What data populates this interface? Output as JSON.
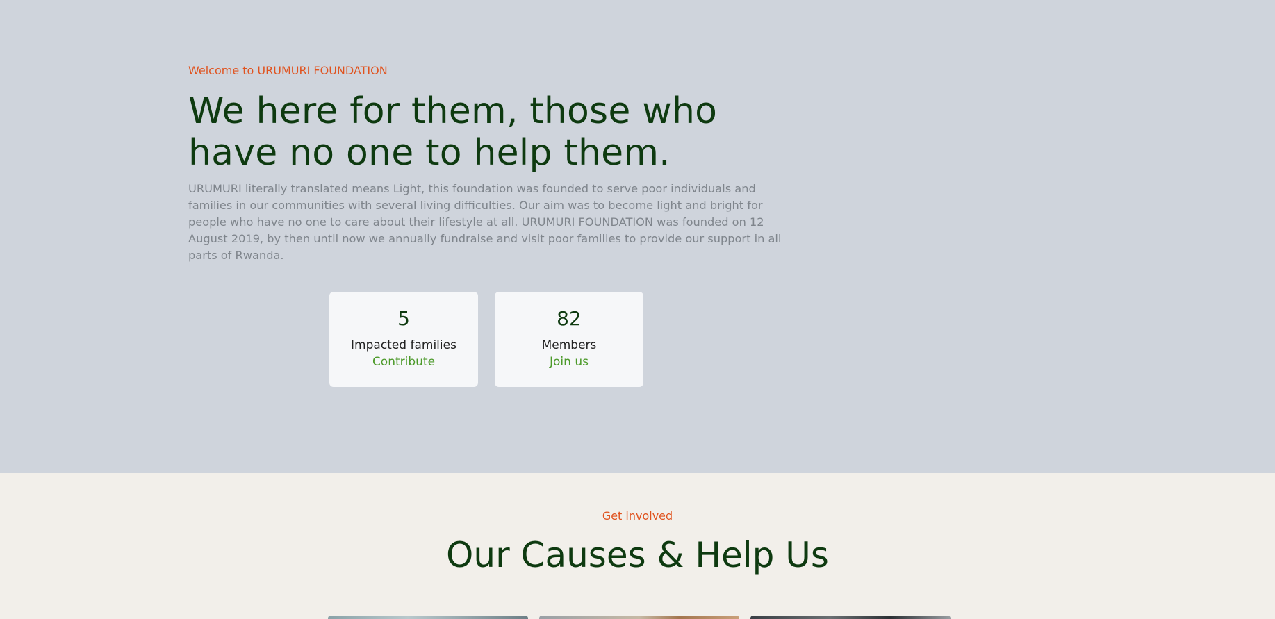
{
  "hero": {
    "eyebrow": "Welcome to URUMURI FOUNDATION",
    "headline": "We here for them, those who have no one to help them.",
    "description": "URUMURI literally translated means Light, this foundation was founded to serve poor individuals and families in our communities with several living difficulties. Our aim was to become light and bright for people who have no one to care about their lifestyle at all. URUMURI FOUNDATION was founded on 12 August 2019, by then until now we annually fundraise and visit poor families to provide our support in all parts of Rwanda."
  },
  "stats": [
    {
      "value": "5",
      "label": "Impacted families",
      "link": "Contribute"
    },
    {
      "value": "82",
      "label": "Members",
      "link": "Join us"
    }
  ],
  "causes": {
    "eyebrow": "Get involved",
    "title": "Our Causes & Help Us"
  },
  "colors": {
    "hero_background": "#cfd4dc",
    "causes_background": "#f2efea",
    "accent_orange": "#e0531f",
    "heading_green": "#0e3a10",
    "link_green": "#4c9a2a"
  }
}
